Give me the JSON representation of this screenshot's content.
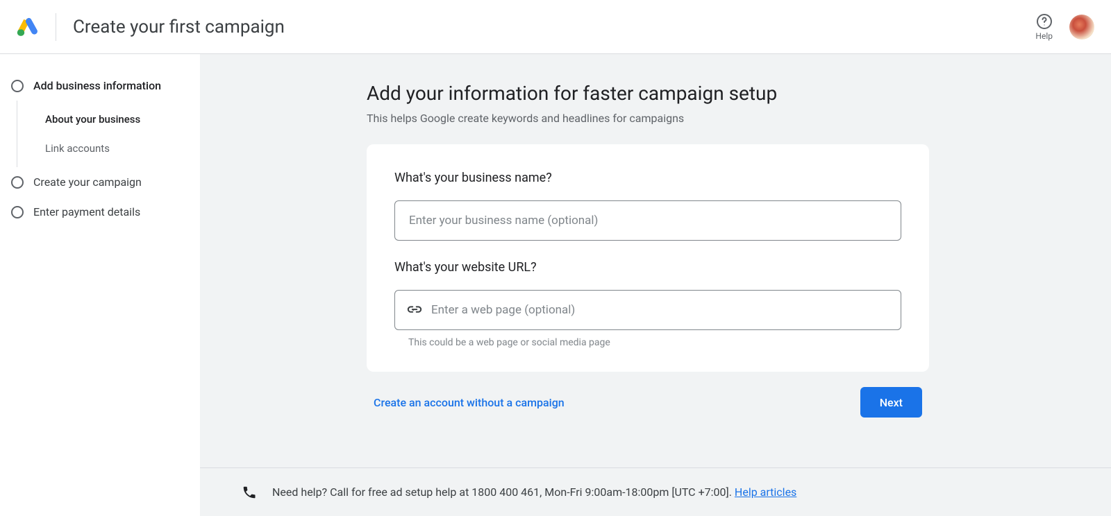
{
  "header": {
    "title": "Create your first campaign",
    "help_label": "Help"
  },
  "sidebar": {
    "steps": [
      {
        "label": "Add business information",
        "sub": [
          "About your business",
          "Link accounts"
        ]
      },
      {
        "label": "Create your campaign"
      },
      {
        "label": "Enter payment details"
      }
    ]
  },
  "main": {
    "heading": "Add your information for faster campaign setup",
    "subheading": "This helps Google create keywords and headlines for campaigns",
    "business_name": {
      "label": "What's your business name?",
      "placeholder": "Enter your business name (optional)",
      "value": ""
    },
    "website_url": {
      "label": "What's your website URL?",
      "placeholder": "Enter a web page (optional)",
      "helper": "This could be a web page or social media page",
      "value": ""
    },
    "skip_link": "Create an account without a campaign",
    "next_label": "Next"
  },
  "footer": {
    "text_prefix": "Need help? Call for free ad setup help at 1800 400 461, Mon-Fri 9:00am-18:00pm [UTC +7:00]. ",
    "link_text": "Help articles"
  }
}
